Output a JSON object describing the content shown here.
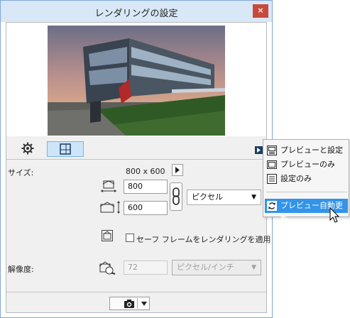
{
  "window": {
    "title": "レンダリングの設定",
    "close_label": "×"
  },
  "preview": {
    "image_desc_icon": "rendered-building-preview"
  },
  "tabs": [
    {
      "icon": "gear-icon",
      "selected": false
    },
    {
      "icon": "size-frame-icon",
      "selected": true
    }
  ],
  "size_section": {
    "label": "サイズ:",
    "dimensions": "800 x 600",
    "width_value": "800",
    "height_value": "600",
    "unit_select": "ピクセル",
    "safe_frame_label": "セーフ フレームをレンダリングを適用"
  },
  "resolution_section": {
    "label": "解像度:",
    "value": "72",
    "unit_select": "ピクセル/インチ"
  },
  "footer": {
    "camera_icon": "camera-icon",
    "dropdown_icon": "triangle-down-icon"
  },
  "popup_menu": {
    "items": [
      {
        "label": "プレビューと設定",
        "icon": "preview-settings-icon"
      },
      {
        "label": "プレビューのみ",
        "icon": "preview-only-icon"
      },
      {
        "label": "設定のみ",
        "icon": "settings-only-icon"
      },
      {
        "label": "プレビュー自動更新",
        "icon": "refresh-icon",
        "highlighted": true
      }
    ]
  },
  "colors": {
    "titlebar": "#d9e8f7",
    "close": "#c84a3b",
    "tab_selected": "#cde4fb",
    "menu_highlight": "#3394ea"
  }
}
